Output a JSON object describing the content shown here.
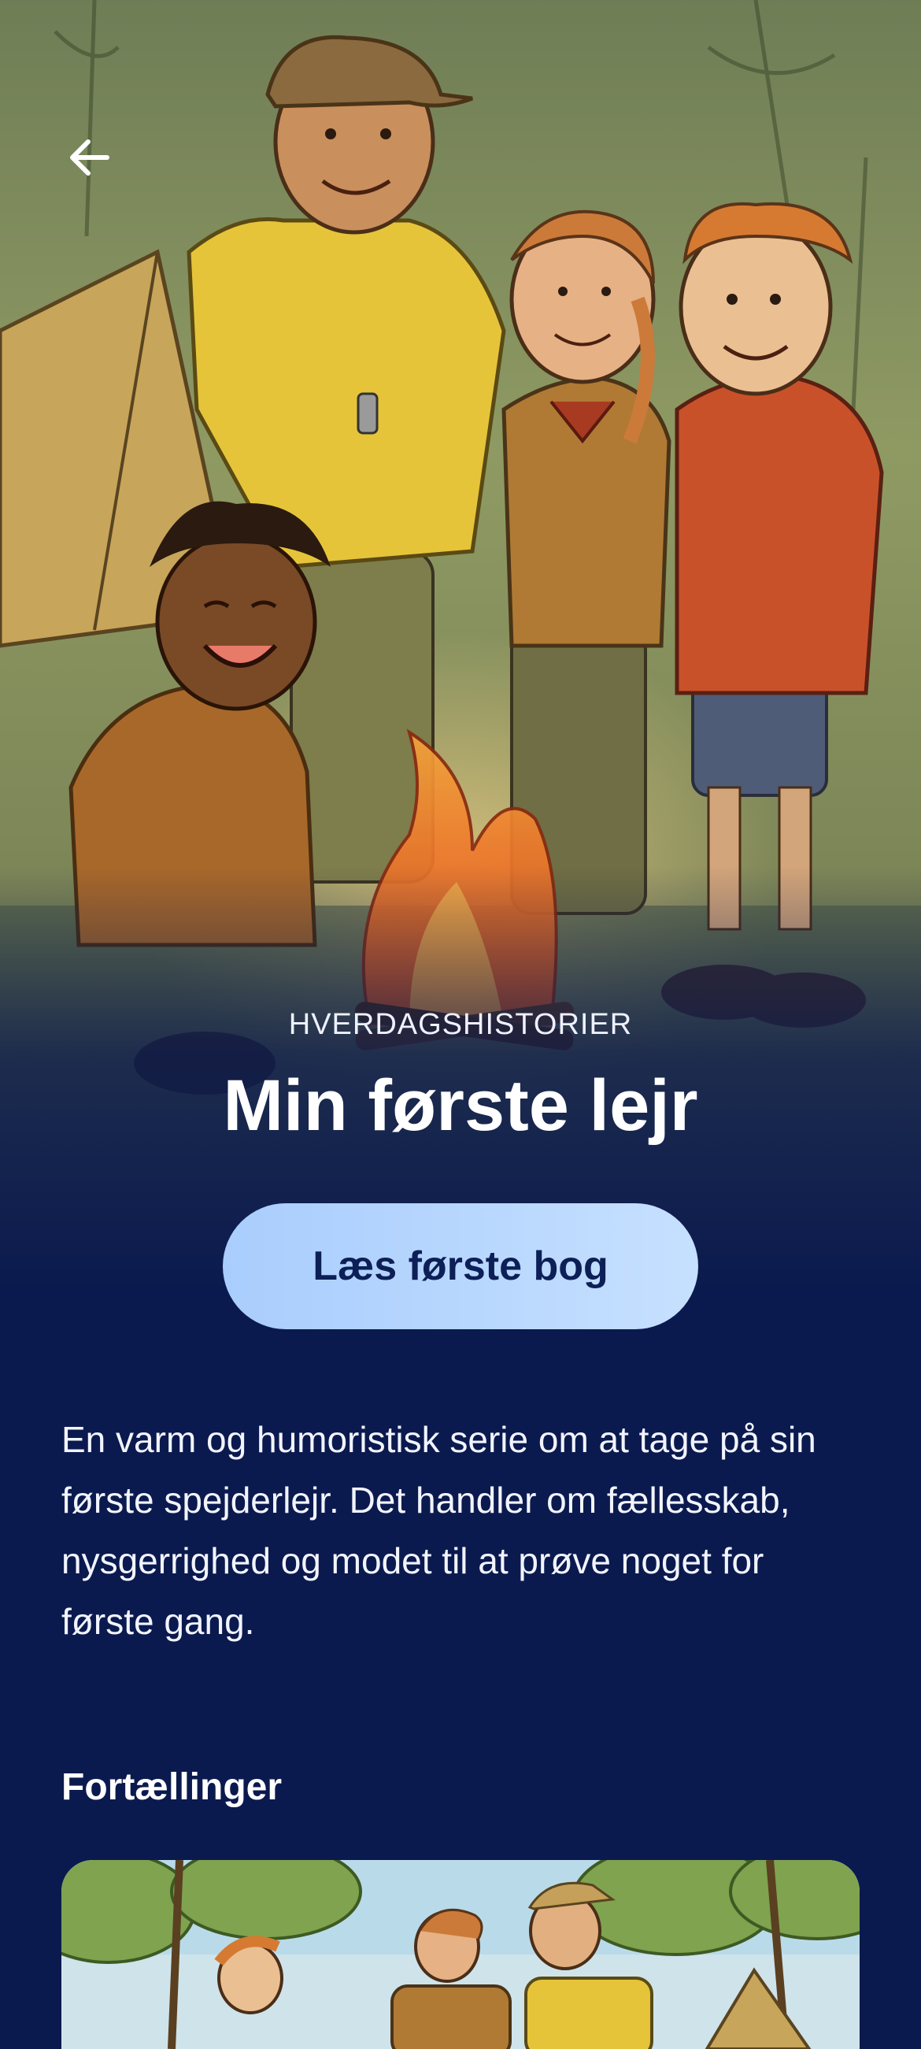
{
  "header": {
    "back_icon": "arrow-left-icon"
  },
  "series": {
    "category": "HVERDAGSHISTORIER",
    "title": "Min første lejr",
    "cta_label": "Læs første bog",
    "description": "En varm og humoristisk serie om at tage på sin første spejderlejr. Det handler om fællesskab, nysgerrighed og modet til at prøve noget for første gang."
  },
  "stories": {
    "heading": "Fortællinger"
  },
  "colors": {
    "background": "#0b1a4e",
    "cta_background": "#b6d6ff",
    "cta_text": "#0d1f57"
  }
}
